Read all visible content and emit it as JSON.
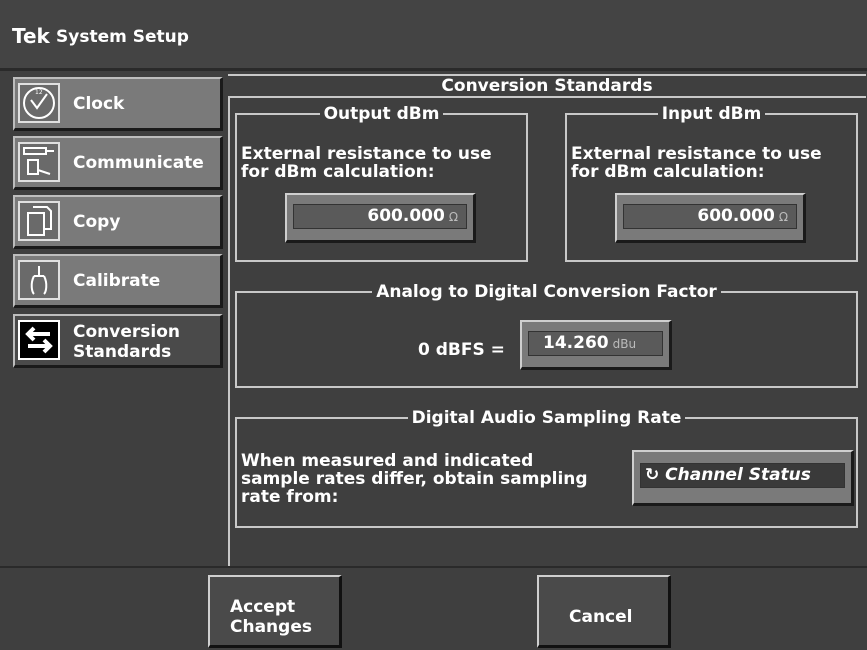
{
  "window": {
    "brand": "Tek",
    "title": "System Setup"
  },
  "nav": [
    {
      "label": "Clock",
      "icon": "clock-icon"
    },
    {
      "label": "Communicate",
      "icon": "communicate-icon"
    },
    {
      "label": "Copy",
      "icon": "copy-icon"
    },
    {
      "label": "Calibrate",
      "icon": "calibrate-icon"
    },
    {
      "label": "Conversion\nStandards",
      "icon": "conversion-arrows-icon",
      "active": true
    }
  ],
  "panel": {
    "title": "Conversion Standards",
    "output_dbm": {
      "legend": "Output dBm",
      "desc_line1": "External resistance to use",
      "desc_line2": "for dBm calculation:",
      "value": "600.000",
      "unit": "Ω"
    },
    "input_dbm": {
      "legend": "Input dBm",
      "desc_line1": "External resistance to use",
      "desc_line2": "for dBm calculation:",
      "value": "600.000",
      "unit": "Ω"
    },
    "adc": {
      "legend": "Analog to Digital Conversion Factor",
      "label": "0 dBFS =",
      "value": "14.260",
      "unit": "dBu"
    },
    "sampling": {
      "legend": "Digital Audio Sampling Rate",
      "desc_line1": "When measured and indicated",
      "desc_line2": "sample rates differ, obtain sampling",
      "desc_line3": "rate from:",
      "selected": "Channel Status"
    }
  },
  "buttons": {
    "accept": "Accept\nChanges",
    "cancel": "Cancel"
  }
}
